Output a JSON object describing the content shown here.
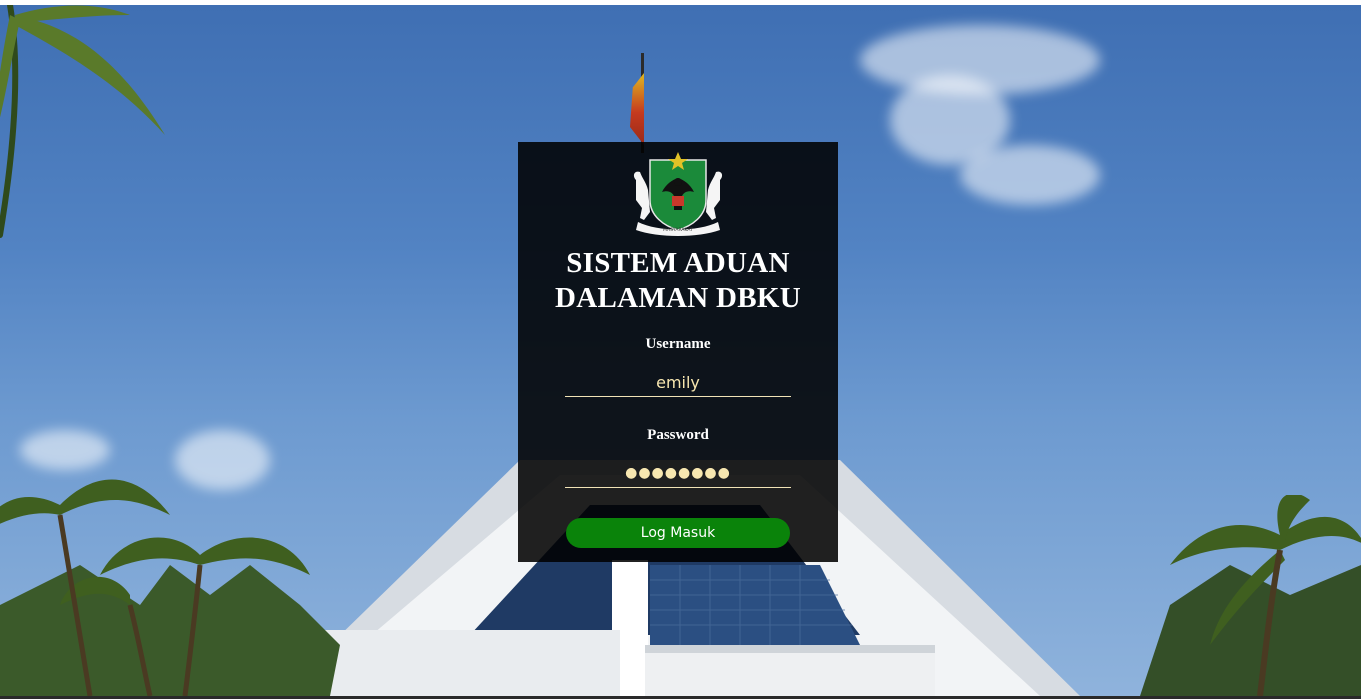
{
  "app": {
    "title_line1": "SISTEM ADUAN",
    "title_line2": "DALAMAN DBKU"
  },
  "logo": {
    "icon": "dbku-coat-of-arms-icon",
    "motto": "MASYARAKAT"
  },
  "form": {
    "username_label": "Username",
    "username_value": "emily",
    "password_label": "Password",
    "password_value": "●●●●●●●●",
    "submit_label": "Log Masuk"
  },
  "colors": {
    "button": "#0a830a",
    "input_text": "#f8e7b0",
    "card_background": "rgba(0,0,0,0.87)"
  }
}
